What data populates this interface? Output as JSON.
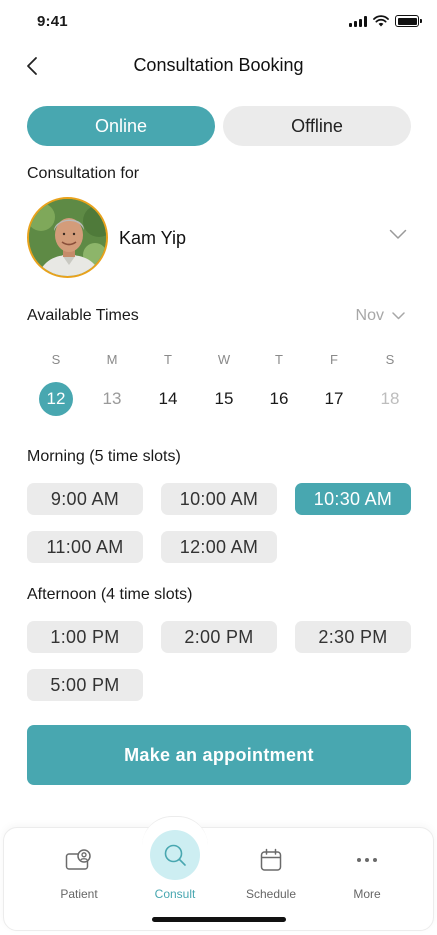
{
  "status_bar": {
    "time": "9:41"
  },
  "header": {
    "title": "Consultation Booking"
  },
  "consult_mode": {
    "options": [
      "Online",
      "Offline"
    ],
    "selected": "Online"
  },
  "patient": {
    "label": "Consultation for",
    "name": "Kam Yip"
  },
  "availability": {
    "label": "Available Times",
    "month": "Nov",
    "weekdays": [
      "S",
      "M",
      "T",
      "W",
      "T",
      "F",
      "S"
    ],
    "days": [
      "12",
      "13",
      "14",
      "15",
      "16",
      "17",
      "18"
    ],
    "selected_day": "12"
  },
  "morning": {
    "label": "Morning (5 time slots)",
    "slots": [
      "9:00 AM",
      "10:00 AM",
      "10:30 AM",
      "11:00 AM",
      "12:00 AM"
    ],
    "selected": "10:30 AM"
  },
  "afternoon": {
    "label": "Afternoon (4 time slots)",
    "slots": [
      "1:00 PM",
      "2:00 PM",
      "2:30 PM",
      "5:00 PM"
    ]
  },
  "cta": {
    "label": "Make an appointment"
  },
  "tabbar": {
    "items": [
      {
        "label": "Patient",
        "icon": "patient-icon"
      },
      {
        "label": "Consult",
        "icon": "search-icon"
      },
      {
        "label": "Schedule",
        "icon": "calendar-icon"
      },
      {
        "label": "More",
        "icon": "more-dots-icon"
      }
    ],
    "active": "Consult"
  },
  "colors": {
    "accent": "#48a7b0",
    "accent_light": "#cdeef2",
    "chip_bg": "#ebebeb",
    "avatar_ring": "#e8a21c"
  }
}
